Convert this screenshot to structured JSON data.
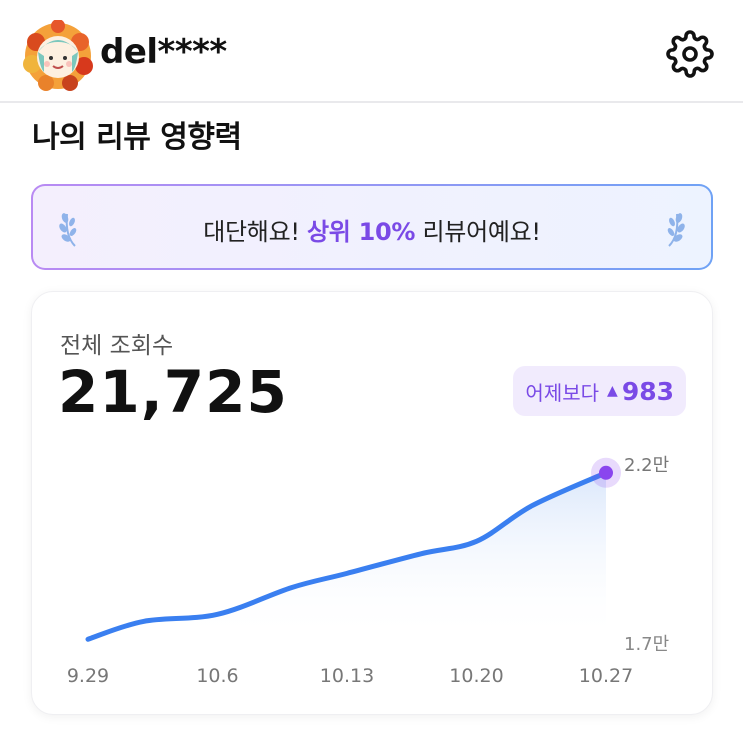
{
  "header": {
    "username": "del****",
    "avatar_icon": "avatar-with-autumn-leaves-wreath",
    "settings_icon": "gear-icon"
  },
  "section": {
    "title": "나의 리뷰 영향력"
  },
  "banner": {
    "text_before": "대단해요! ",
    "highlight": "상위 10%",
    "text_after": " 리뷰어예요!",
    "highlight_color": "#7a4ae6"
  },
  "views_card": {
    "label": "전체 조회수",
    "total": "21,725",
    "delta_label": "어제보다",
    "delta_value": "983",
    "delta_direction": "up"
  },
  "chart_data": {
    "type": "area",
    "x": [
      "9.29",
      "10.6",
      "10.13",
      "10.20",
      "10.27"
    ],
    "y_labels": [
      "2.2만",
      "1.7만"
    ],
    "ylim": [
      17000,
      22000
    ],
    "points": [
      {
        "x": "9.29",
        "y": 17050
      },
      {
        "x": "10.2",
        "y": 17550
      },
      {
        "x": "10.6",
        "y": 17750
      },
      {
        "x": "10.10",
        "y": 18500
      },
      {
        "x": "10.13",
        "y": 18900
      },
      {
        "x": "10.17",
        "y": 19450
      },
      {
        "x": "10.20",
        "y": 19800
      },
      {
        "x": "10.23",
        "y": 20800
      },
      {
        "x": "10.27",
        "y": 21725
      }
    ],
    "line_color": "#3a7ff0",
    "marker_color": "#8a45ee",
    "grid": false
  }
}
